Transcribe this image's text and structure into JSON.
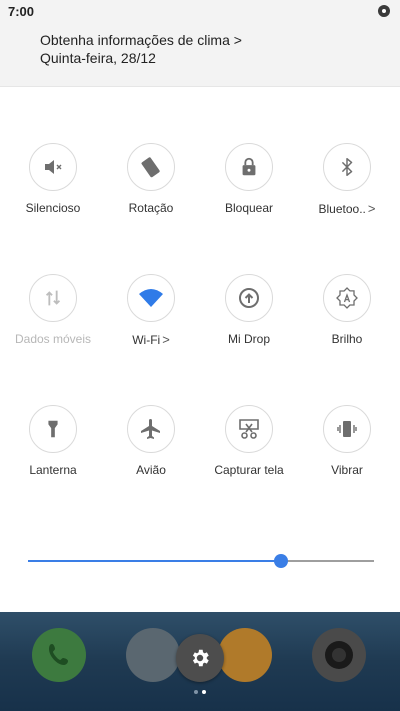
{
  "status_bar": {
    "time": "7:00"
  },
  "weather": {
    "title": "Obtenha informações de clima >",
    "date": "Quinta-feira, 28/12"
  },
  "tiles": [
    {
      "label": "Silencioso",
      "icon": "mute-speaker-icon"
    },
    {
      "label": "Rotação",
      "icon": "rotation-icon"
    },
    {
      "label": "Bloquear",
      "icon": "lock-icon"
    },
    {
      "label": "Bluetoo..",
      "icon": "bluetooth-icon",
      "chevron": ">"
    },
    {
      "label": "Dados móveis",
      "icon": "mobile-data-icon",
      "disabled": true
    },
    {
      "label": "Wi-Fi",
      "icon": "wifi-icon",
      "chevron": ">",
      "active": true
    },
    {
      "label": "Mi Drop",
      "icon": "mi-drop-icon"
    },
    {
      "label": "Brilho",
      "icon": "auto-brightness-icon"
    },
    {
      "label": "Lanterna",
      "icon": "flashlight-icon"
    },
    {
      "label": "Avião",
      "icon": "airplane-icon"
    },
    {
      "label": "Capturar tela",
      "icon": "screenshot-icon"
    },
    {
      "label": "Vibrar",
      "icon": "vibrate-icon"
    }
  ],
  "brightness": {
    "level": 0.74
  },
  "colors": {
    "accent": "#3a7ee6",
    "icon_gray": "#6e6e6e"
  },
  "dock": {
    "apps": [
      "phone-icon",
      "browser-icon",
      "messages-icon",
      "camera-icon"
    ],
    "settings_icon": "gear-icon",
    "pages": 2,
    "current_page": 2
  }
}
